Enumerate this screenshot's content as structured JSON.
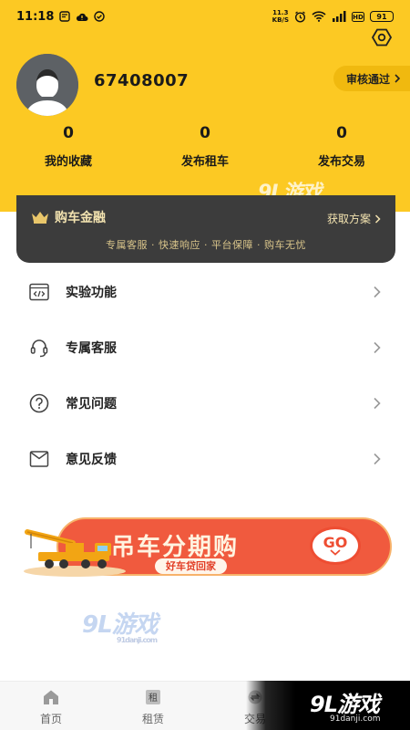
{
  "status_bar": {
    "time": "11:18",
    "net_speed_value": "11.3",
    "net_speed_unit": "KB/S",
    "battery": "91"
  },
  "profile": {
    "username": "67408007",
    "review_status": "审核通过"
  },
  "stats": [
    {
      "value": "0",
      "label": "我的收藏"
    },
    {
      "value": "0",
      "label": "发布租车"
    },
    {
      "value": "0",
      "label": "发布交易"
    }
  ],
  "finance": {
    "title": "购车金融",
    "link": "获取方案",
    "subtitle": "专属客服 · 快速响应 · 平台保障 · 购车无忧"
  },
  "menu": [
    {
      "label": "实验功能",
      "icon": "code-icon"
    },
    {
      "label": "专属客服",
      "icon": "headset-icon"
    },
    {
      "label": "常见问题",
      "icon": "question-icon"
    },
    {
      "label": "意见反馈",
      "icon": "mail-icon"
    }
  ],
  "banner": {
    "title": "吊车分期购",
    "subtitle": "好车贷回家",
    "go": "GO"
  },
  "watermark": {
    "text": "9L游戏",
    "site": "91danji.com"
  },
  "tabs": [
    {
      "label": "首页"
    },
    {
      "label": "租赁",
      "icon_text": "租"
    },
    {
      "label": "交易"
    }
  ],
  "colors": {
    "header_bg": "#fcc923",
    "finance_bg": "#3c3c3c",
    "banner_bg": "#f05a3e"
  }
}
